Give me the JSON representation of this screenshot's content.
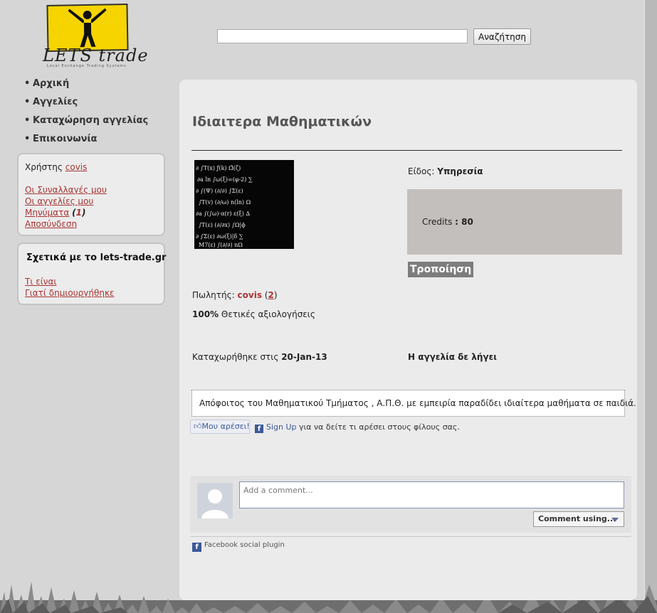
{
  "logo": {
    "text": "LETS trade",
    "subtitle": "Local Exchange Trading Systems"
  },
  "search": {
    "value": "",
    "placeholder": "",
    "button_label": "Αναζήτηση"
  },
  "nav": {
    "items": [
      "Αρχική",
      "Αγγελίες",
      "Καταχώρηση αγγελίας",
      "Επικοινωνία"
    ]
  },
  "user_box": {
    "user_label": "Χρήστης",
    "username": "covis",
    "links": {
      "transactions": "Οι Συναλλαγές μου",
      "my_ads": "Οι αγγελίες μου",
      "messages": "Μηνύματα",
      "logout": "Αποσύνδεση"
    },
    "messages_count": "1"
  },
  "about_box": {
    "title": "Σχετικά με το lets-trade.gr",
    "links": [
      "Τι είναι",
      "Γιατί δημιουργήθηκε"
    ]
  },
  "listing": {
    "title": "Ιδιαιτερα Μαθηματικών",
    "kind_label": "Είδος:",
    "kind_value": "Υπηρεσία",
    "credits_label": "Credits",
    "credits_value": "80",
    "edit_label": "Τροποίηση",
    "seller_label": "Πωλητής:",
    "seller_name": "covis",
    "seller_count": "2",
    "rating_percent": "100%",
    "rating_text": "Θετικές αξιολογήσεις",
    "registered_label": "Καταχωρήθηκε στις",
    "registered_date": "20-Jan-13",
    "expires_text": "Η αγγελία δε λήγει",
    "description": "Απόφοιτος του Μαθηματικού Τμήματος , Α.Π.Θ. με εμπειρία παραδίδει ιδιαίτερα μαθήματα σε παιδιά."
  },
  "facebook": {
    "like_label": "Μου αρέσει!",
    "sign_up": "Sign Up",
    "sign_up_text": "για να δείτε τι αρέσει στους φίλους σας.",
    "comment_placeholder": "Add a comment...",
    "comment_using": "Comment using...",
    "plugin_label": "Facebook social plugin"
  },
  "colors": {
    "accent_link": "#aa3333",
    "facebook_blue": "#3b5998",
    "credits_bg": "#c3bfbd",
    "logo_yellow": "#f5d400"
  }
}
